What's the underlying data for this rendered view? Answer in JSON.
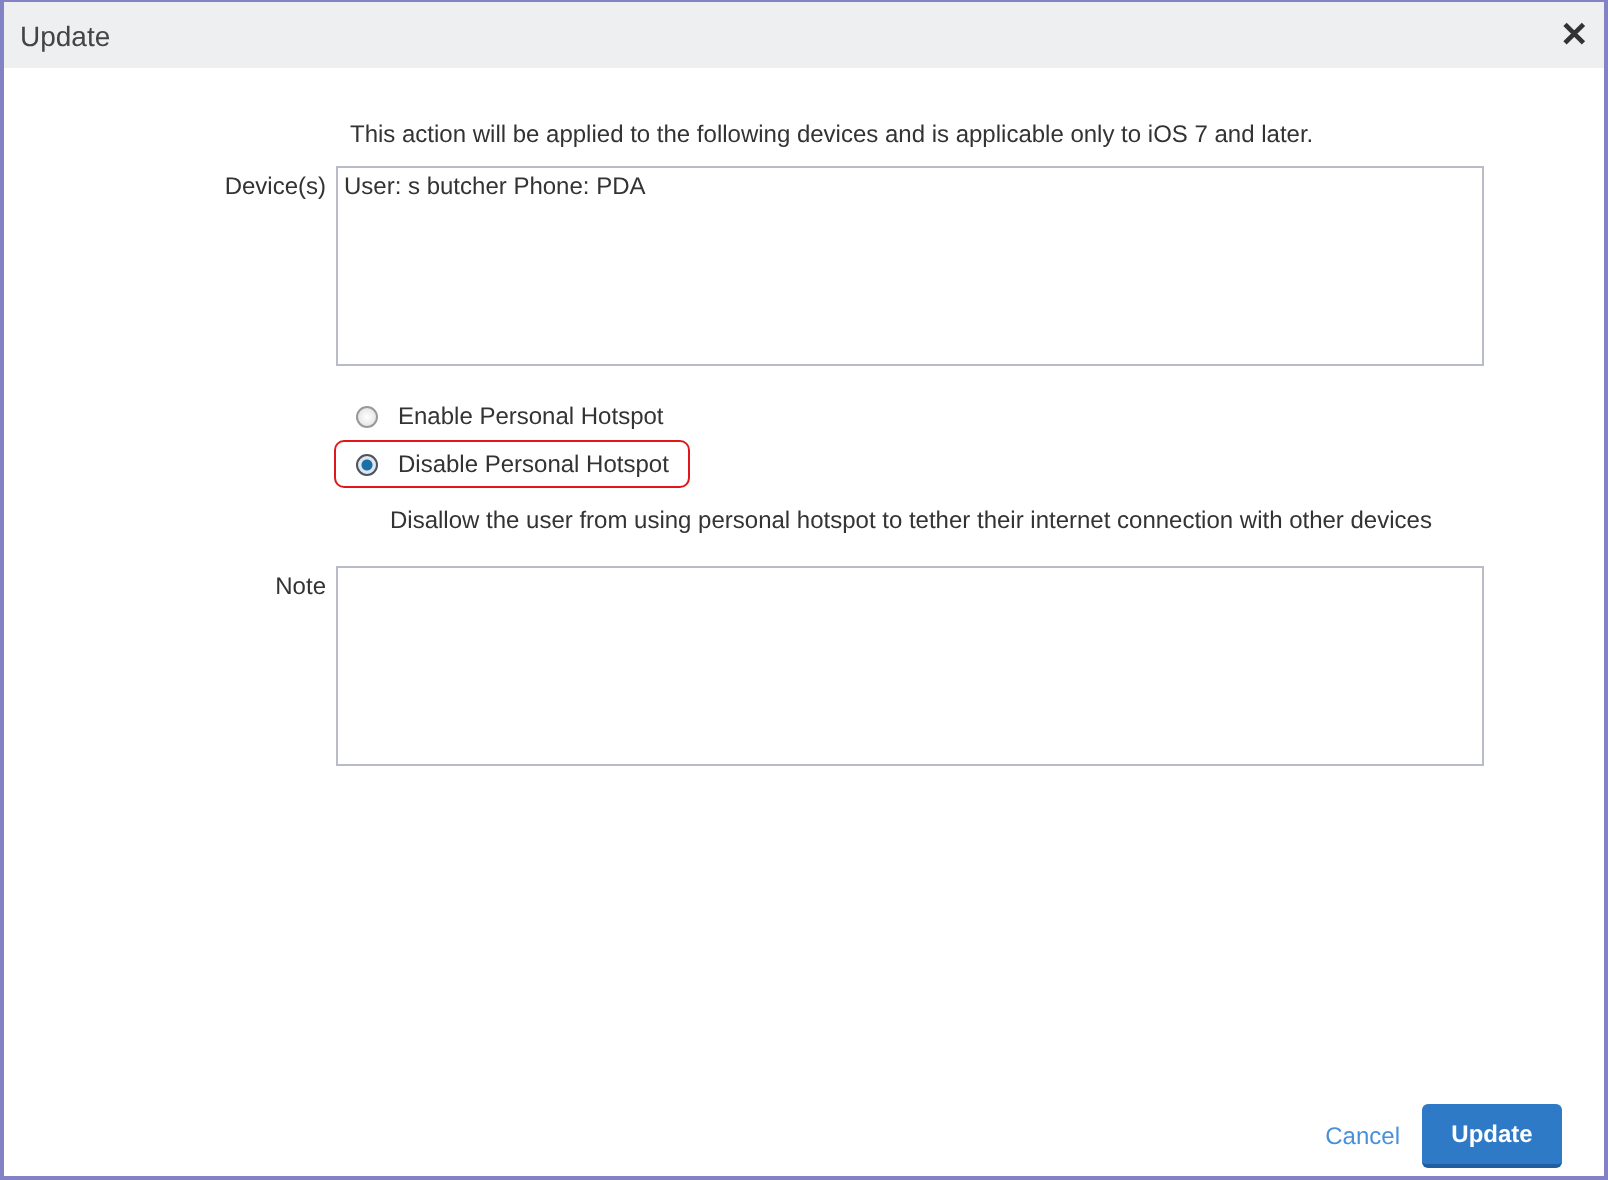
{
  "window": {
    "title": "Update",
    "close": "✕"
  },
  "intro": "This action will be applied to the following devices and is applicable only to iOS 7 and later.",
  "devices": {
    "label": "Device(s)",
    "value": "User: s butcher Phone: PDA"
  },
  "options": [
    {
      "label": "Enable Personal Hotspot",
      "selected": false
    },
    {
      "label": "Disable Personal Hotspot",
      "selected": true
    }
  ],
  "description": "Disallow the user from using personal hotspot to tether their internet connection with other devices",
  "note": {
    "label": "Note"
  },
  "buttons": [
    {
      "kind": "link",
      "label": "Cancel"
    },
    {
      "kind": "primary",
      "label": "Update"
    }
  ]
}
